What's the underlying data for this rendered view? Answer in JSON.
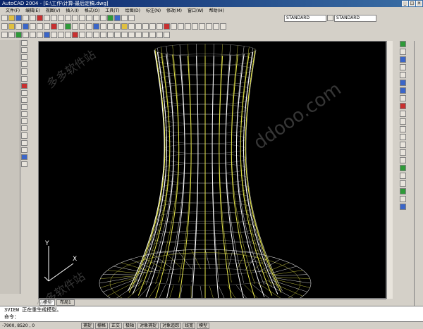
{
  "window": {
    "title": "AutoCAD 2004 - [E:\\工作\\计算-最后定稿.dwg]",
    "colors": {
      "title_bar": "#0a246a",
      "viewport_bg": "#000000",
      "mesh_white": "#ffffff",
      "mesh_yellow": "#e6e64a"
    }
  },
  "menubar": {
    "items": [
      "文件(F)",
      "编辑(E)",
      "视图(V)",
      "插入(I)",
      "格式(O)",
      "工具(T)",
      "绘图(D)",
      "标注(N)",
      "修改(M)",
      "窗口(W)",
      "帮助(H)"
    ]
  },
  "toolbar": {
    "text_style": "STANDARD",
    "dim_style": "STANDARD"
  },
  "tabs": {
    "model": "模型",
    "layout1": "布局1"
  },
  "command": {
    "line1": "3VIEW 正在重生成模型。",
    "line2": "命令："
  },
  "status": {
    "coord": "-7900, 8520 , 0",
    "buttons": [
      "捕捉",
      "栅格",
      "正交",
      "极轴",
      "对象捕捉",
      "对象追踪",
      "线宽",
      "模型"
    ]
  },
  "ucs": {
    "x_label": "X",
    "y_label": "Y"
  },
  "watermark": {
    "text": "ddooo.com",
    "text_cn": "多多软件站"
  }
}
